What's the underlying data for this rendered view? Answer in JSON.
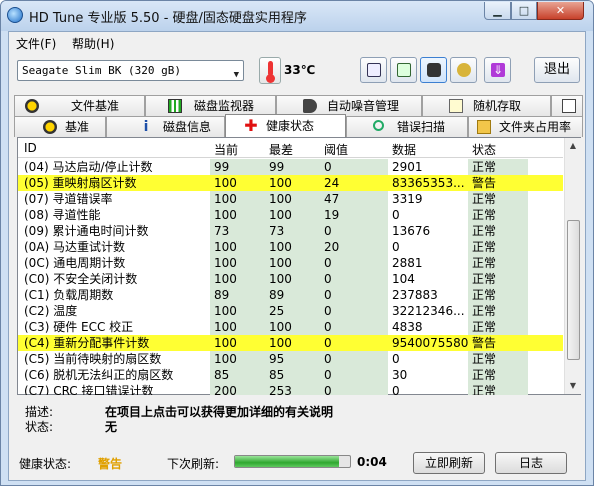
{
  "window": {
    "title": "HD Tune 专业版 5.50 - 硬盘/固态硬盘实用程序",
    "min": "▁",
    "max": "□",
    "close": "✕"
  },
  "menu": [
    {
      "label": "文件(F)"
    },
    {
      "label": "帮助(H)"
    }
  ],
  "toolbar": {
    "drive": "Seagate Slim BK (320 gB)",
    "temperature": "33℃",
    "exit_label": "退出"
  },
  "tabs_top": [
    {
      "label": "文件基准",
      "icon": "file-benchmark-icon"
    },
    {
      "label": "磁盘监视器",
      "icon": "disk-monitor-icon"
    },
    {
      "label": "自动噪音管理",
      "icon": "speaker-icon"
    },
    {
      "label": "随机存取",
      "icon": "random-access-icon"
    },
    {
      "label": "",
      "icon": "extra-icon"
    }
  ],
  "tabs_bottom": [
    {
      "label": "基准",
      "icon": "benchmark-icon"
    },
    {
      "label": "磁盘信息",
      "icon": "info-icon"
    },
    {
      "label": "健康状态",
      "icon": "health-cross-icon"
    },
    {
      "label": "错误扫描",
      "icon": "magnifier-icon"
    },
    {
      "label": "文件夹占用率",
      "icon": "folder-icon"
    }
  ],
  "grid": {
    "headers": [
      "ID",
      "当前",
      "最差",
      "阈值",
      "数据",
      "状态"
    ],
    "rows": [
      {
        "id": "(04) 马达启动/停止计数",
        "cur": "99",
        "worst": "99",
        "th": "0",
        "data": "2901",
        "status": "正常",
        "warn": false
      },
      {
        "id": "(05) 重映射扇区计数",
        "cur": "100",
        "worst": "100",
        "th": "24",
        "data": "83365353...",
        "status": "警告",
        "warn": true
      },
      {
        "id": "(07) 寻道错误率",
        "cur": "100",
        "worst": "100",
        "th": "47",
        "data": "3319",
        "status": "正常",
        "warn": false
      },
      {
        "id": "(08) 寻道性能",
        "cur": "100",
        "worst": "100",
        "th": "19",
        "data": "0",
        "status": "正常",
        "warn": false
      },
      {
        "id": "(09) 累计通电时间计数",
        "cur": "73",
        "worst": "73",
        "th": "0",
        "data": "13676",
        "status": "正常",
        "warn": false
      },
      {
        "id": "(0A) 马达重试计数",
        "cur": "100",
        "worst": "100",
        "th": "20",
        "data": "0",
        "status": "正常",
        "warn": false
      },
      {
        "id": "(0C) 通电周期计数",
        "cur": "100",
        "worst": "100",
        "th": "0",
        "data": "2881",
        "status": "正常",
        "warn": false
      },
      {
        "id": "(C0) 不安全关闭计数",
        "cur": "100",
        "worst": "100",
        "th": "0",
        "data": "104",
        "status": "正常",
        "warn": false
      },
      {
        "id": "(C1) 负载周期数",
        "cur": "89",
        "worst": "89",
        "th": "0",
        "data": "237883",
        "status": "正常",
        "warn": false
      },
      {
        "id": "(C2) 温度",
        "cur": "100",
        "worst": "25",
        "th": "0",
        "data": "32212346...",
        "status": "正常",
        "warn": false
      },
      {
        "id": "(C3) 硬件 ECC 校正",
        "cur": "100",
        "worst": "100",
        "th": "0",
        "data": "4838",
        "status": "正常",
        "warn": false
      },
      {
        "id": "(C4) 重新分配事件计数",
        "cur": "100",
        "worst": "100",
        "th": "0",
        "data": "9540075580",
        "status": "警告",
        "warn": true
      },
      {
        "id": "(C5) 当前待映射的扇区数",
        "cur": "100",
        "worst": "95",
        "th": "0",
        "data": "0",
        "status": "正常",
        "warn": false
      },
      {
        "id": "(C6) 脱机无法纠正的扇区数",
        "cur": "85",
        "worst": "85",
        "th": "0",
        "data": "30",
        "status": "正常",
        "warn": false
      },
      {
        "id": "(C7) CRC 接口错误计数",
        "cur": "200",
        "worst": "253",
        "th": "0",
        "data": "0",
        "status": "正常",
        "warn": false
      }
    ]
  },
  "details": {
    "desc_label": "描述:",
    "desc_value": "在项目上点击可以获得更加详细的有关说明",
    "status_label": "状态:",
    "status_value": "无"
  },
  "status": {
    "health_label": "健康状态:",
    "health_value": "警告",
    "next_refresh_label": "下次刷新:",
    "progress": 0.9,
    "countdown": "0:04",
    "refresh_label": "立即刷新",
    "log_label": "日志"
  },
  "colors": {
    "warn_row": "#ffff33",
    "shade": "#d9e9d9",
    "health_warn": "#e0a000",
    "progress": "#2fa82f"
  }
}
